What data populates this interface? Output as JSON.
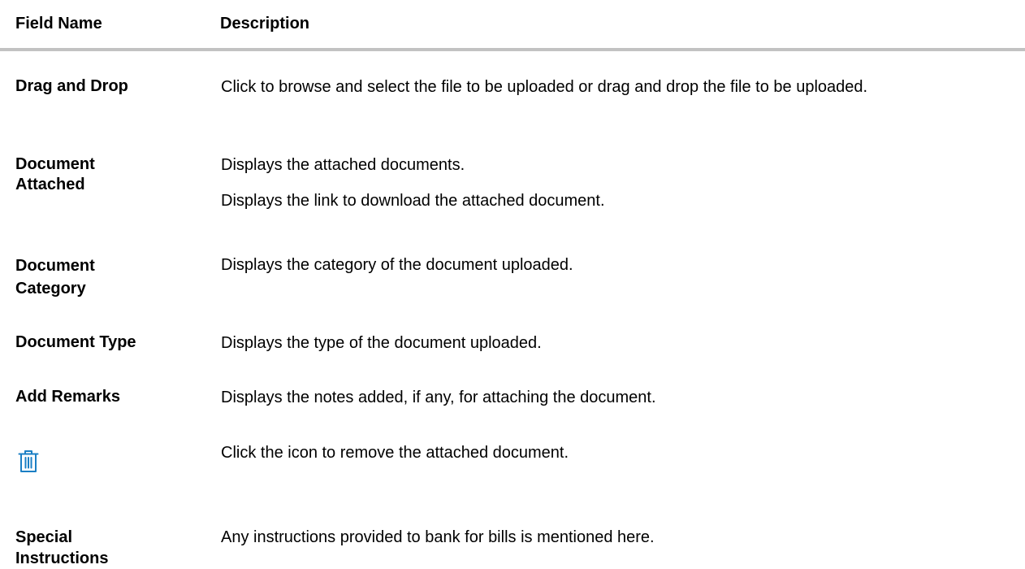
{
  "table": {
    "headers": {
      "field": "Field Name",
      "description": "Description"
    },
    "rows": [
      {
        "field": "Drag and Drop",
        "descriptions": [
          "Click to browse and select the file to be uploaded or drag and drop the file to be uploaded."
        ]
      },
      {
        "field": "Document Attached",
        "descriptions": [
          "Displays the attached documents.",
          "Displays the link to download the attached document."
        ]
      },
      {
        "field": "Document Category",
        "descriptions": [
          "Displays the category of the document uploaded."
        ]
      },
      {
        "field": "Document Type",
        "descriptions": [
          "Displays the type of the document uploaded."
        ]
      },
      {
        "field": "Add Remarks",
        "descriptions": [
          "Displays the notes added, if any, for attaching the document."
        ]
      },
      {
        "field": "",
        "icon": "trash-icon",
        "descriptions": [
          "Click the icon to remove the attached document."
        ]
      },
      {
        "field": "Special Instructions",
        "descriptions": [
          "Any instructions provided to bank for bills is mentioned here."
        ]
      }
    ]
  },
  "colors": {
    "icon": "#1b7fc4",
    "rule": "#c2c2c2"
  }
}
